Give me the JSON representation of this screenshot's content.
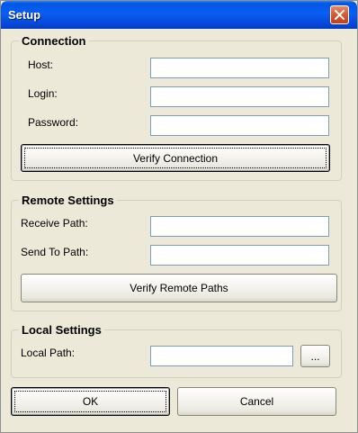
{
  "window": {
    "title": "Setup"
  },
  "connection": {
    "legend": "Connection",
    "host_label": "Host:",
    "host_value": "",
    "login_label": "Login:",
    "login_value": "",
    "password_label": "Password:",
    "password_value": "",
    "verify_label": "Verify Connection"
  },
  "remote": {
    "legend": "Remote Settings",
    "receive_label": "Receive Path:",
    "receive_value": "",
    "send_label": "Send To Path:",
    "send_value": "",
    "verify_label": "Verify Remote Paths"
  },
  "local": {
    "legend": "Local Settings",
    "path_label": "Local Path:",
    "path_value": "",
    "browse_label": "..."
  },
  "footer": {
    "ok_label": "OK",
    "cancel_label": "Cancel"
  },
  "icons": {
    "close": "close-icon"
  },
  "colors": {
    "window_bg": "#ECE9D8",
    "titlebar": "#0058E6",
    "close": "#D9572F"
  }
}
